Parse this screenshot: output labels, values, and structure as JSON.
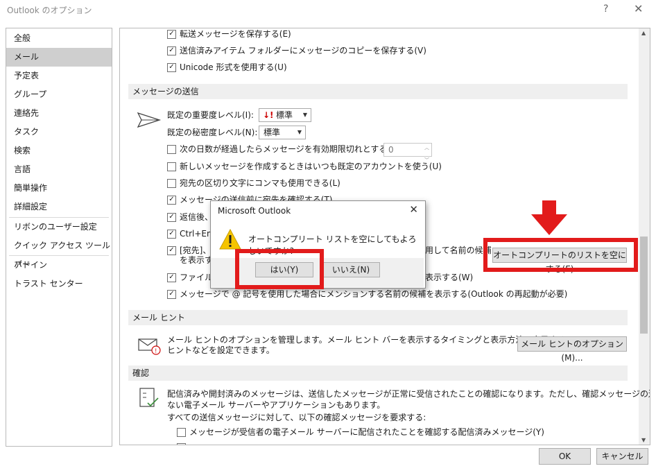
{
  "window": {
    "title": "Outlook のオプション",
    "help_label": "?",
    "close_label": "✕"
  },
  "nav": {
    "items": [
      "全般",
      "メール",
      "予定表",
      "グループ",
      "連絡先",
      "タスク",
      "検索",
      "言語",
      "簡単操作",
      "詳細設定",
      "リボンのユーザー設定",
      "クイック アクセス ツール バー",
      "アドイン",
      "トラスト センター"
    ],
    "selected": "メール"
  },
  "save": {
    "forwarded": "転送メッセージを保存する(E)",
    "sent_copy": "送信済みアイテム フォルダーにメッセージのコピーを保存する(V)",
    "unicode": "Unicode 形式を使用する(U)"
  },
  "send": {
    "header": "メッセージの送信",
    "importance_label": "既定の重要度レベル(I):",
    "importance_value": "標準",
    "sensitivity_label": "既定の秘密度レベル(N):",
    "sensitivity_value": "標準",
    "expire_label": "次の日数が経過したらメッセージを有効期限切れとする(A):",
    "expire_value": "0",
    "default_account": "新しいメッセージを作成するときはいつも既定のアカウントを使う(U)",
    "comma_sep": "宛先の区切り文字にコンマも使用できる(L)",
    "check_names": "メッセージの送信前に宛先を確認する(T)",
    "after_reply": "返信後、",
    "ctrl_enter": "Ctrl+Enter",
    "autocomplete_1": "[宛先]、",
    "autocomplete_1b": "用して名前の候補",
    "autocomplete_2": "を表示す",
    "file_warn": "ファイルが",
    "file_warn_tail": "表示する(W)",
    "mention": "メッセージで @ 記号を使用した場合にメンションする名前の候補を表示する(Outlook の再起動が必要)",
    "empty_autocomplete_button": "オートコンプリートのリストを空にする(E)"
  },
  "mailtips": {
    "header": "メール ヒント",
    "description_1": "メール ヒントのオプションを管理します。メール ヒント バーを表示するタイミングと表示方法、表示するメール",
    "description_2": "ヒントなどを設定できます。",
    "options_button": "メール ヒントのオプション(M)..."
  },
  "tracking": {
    "header": "確認",
    "description_1": "配信済みや開封済みのメッセージは、送信したメッセージが正常に受信されたことの確認になります。ただし、確認メッセージの送信に対応してい",
    "description_2": "ない電子メール サーバーやアプリケーションもあります。",
    "for_all": "すべての送信メッセージに対して、以下の確認メッセージを要求する:",
    "delivery_receipt": "メッセージが受信者の電子メール サーバーに配信されたことを確認する配信済みメッセージ(Y)"
  },
  "footer": {
    "ok": "OK",
    "cancel": "キャンセル"
  },
  "dialog": {
    "title": "Microsoft Outlook",
    "message": "オートコンプリート リストを空にしてもよろしいですか?",
    "yes": "はい(Y)",
    "no": "いいえ(N)",
    "icon": "warning-icon"
  },
  "colors": {
    "highlight": "#e21b1b",
    "nav_selected": "#cfcfcf",
    "section": "#efefef"
  }
}
